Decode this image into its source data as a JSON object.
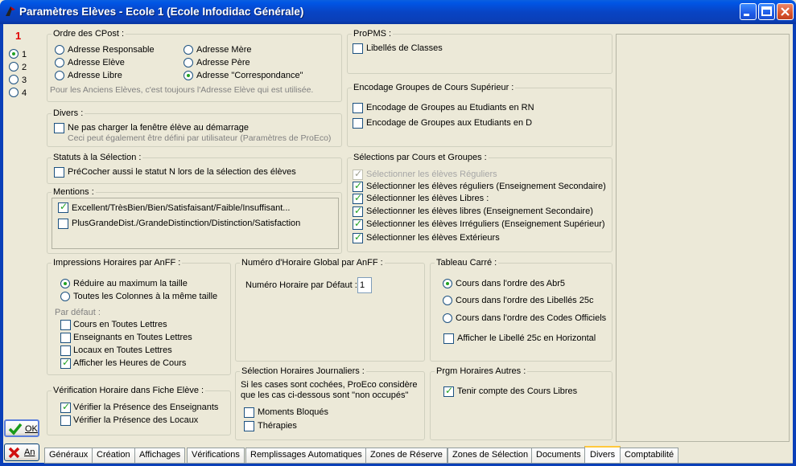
{
  "window": {
    "title": "Paramètres Elèves - Ecole 1 (Ecole Infodidac Générale)"
  },
  "left": {
    "number": "1",
    "radios": [
      {
        "label": "1",
        "selected": true
      },
      {
        "label": "2",
        "selected": false
      },
      {
        "label": "3",
        "selected": false
      },
      {
        "label": "4",
        "selected": false
      }
    ],
    "ok_label": "OK",
    "cancel_label": "An"
  },
  "cpost": {
    "title": "Ordre des CPost :",
    "options": [
      "Adresse Responsable",
      "Adresse Elève",
      "Adresse Libre",
      "Adresse Mère",
      "Adresse Père",
      "Adresse \"Correspondance\""
    ],
    "selected_index": 5,
    "note": "Pour les Anciens Elèves, c'est toujours l'Adresse Elève qui est utilisée."
  },
  "divers": {
    "title": "Divers :",
    "option": "Ne pas charger la fenêtre élève au démarrage",
    "checked": false,
    "note": "Ceci peut également être défini par utilisateur (Paramètres de ProEco)"
  },
  "statuts": {
    "title": "Statuts à la Sélection :",
    "option": "PréCocher aussi le statut N lors de la sélection des élèves",
    "checked": false
  },
  "mentions": {
    "title": "Mentions :",
    "options": [
      {
        "label": "Excellent/TrèsBien/Bien/Satisfaisant/Faible/Insuffisant...",
        "checked": true
      },
      {
        "label": "PlusGrandeDist./GrandeDistinction/Distinction/Satisfaction",
        "checked": false
      }
    ]
  },
  "propms": {
    "title": "ProPMS :",
    "option": "Libellés de Classes",
    "checked": false
  },
  "encodage": {
    "title": "Encodage Groupes de Cours Supérieur :",
    "options": [
      {
        "label": "Encodage de Groupes au Etudiants en RN",
        "checked": false
      },
      {
        "label": "Encodage de Groupes aux Etudiants en D",
        "checked": false
      }
    ]
  },
  "selections": {
    "title": "Sélections par Cours et Groupes :",
    "options": [
      {
        "label": "Sélectionner les élèves Réguliers",
        "checked": true,
        "disabled": true
      },
      {
        "label": "Sélectionner les élèves réguliers (Enseignement Secondaire)",
        "checked": true,
        "disabled": false
      },
      {
        "label": "Sélectionner les élèves Libres :",
        "checked": true,
        "disabled": false
      },
      {
        "label": "Sélectionner les élèves libres (Enseignement Secondaire)",
        "checked": true,
        "disabled": false
      },
      {
        "label": "Sélectionner les élèves Irréguliers (Enseignement Supérieur)",
        "checked": true,
        "disabled": false
      },
      {
        "label": "Sélectionner les élèves Extérieurs",
        "checked": true,
        "disabled": false
      }
    ]
  },
  "impressions": {
    "title": "Impressions Horaires par AnFF :",
    "radios": [
      {
        "label": "Réduire au maximum la taille",
        "selected": true
      },
      {
        "label": "Toutes les Colonnes à la même taille",
        "selected": false
      }
    ],
    "default_label": "Par défaut :",
    "checks": [
      {
        "label": "Cours en Toutes Lettres",
        "checked": false
      },
      {
        "label": "Enseignants en Toutes Lettres",
        "checked": false
      },
      {
        "label": "Locaux en Toutes Lettres",
        "checked": false
      },
      {
        "label": "Afficher les Heures de Cours",
        "checked": true
      }
    ]
  },
  "verification": {
    "title": "Vérification Horaire dans Fiche Elève :",
    "checks": [
      {
        "label": "Vérifier la Présence des Enseignants",
        "checked": true
      },
      {
        "label": "Vérifier la Présence des Locaux",
        "checked": false
      }
    ]
  },
  "numero": {
    "title": "Numéro d'Horaire Global par AnFF :",
    "label": "Numéro Horaire par Défaut :",
    "value": "1"
  },
  "journaliers": {
    "title": "Sélection Horaires Journaliers :",
    "note_line1": "Si les cases sont cochées, ProEco considère",
    "note_line2": "que les cas ci-dessous sont \"non occupés\"",
    "checks": [
      {
        "label": "Moments Bloqués",
        "checked": false
      },
      {
        "label": "Thérapies",
        "checked": false
      }
    ]
  },
  "carre": {
    "title": "Tableau Carré :",
    "radios": [
      {
        "label": "Cours dans l'ordre des Abr5",
        "selected": true
      },
      {
        "label": "Cours dans l'ordre des Libellés 25c",
        "selected": false
      },
      {
        "label": "Cours dans l'ordre des Codes Officiels",
        "selected": false
      }
    ],
    "check": {
      "label": "Afficher le Libellé 25c en Horizontal",
      "checked": false
    }
  },
  "prgm": {
    "title": "Prgm Horaires Autres :",
    "check": {
      "label": "Tenir compte des Cours Libres",
      "checked": true
    }
  },
  "tabs": [
    "Généraux",
    "Création",
    "Affichages",
    "Vérifications",
    "Remplissages Automatiques",
    "Zones de Réserve",
    "Zones de Sélection",
    "Documents",
    "Divers",
    "Comptabilité"
  ],
  "active_tab": "Divers"
}
